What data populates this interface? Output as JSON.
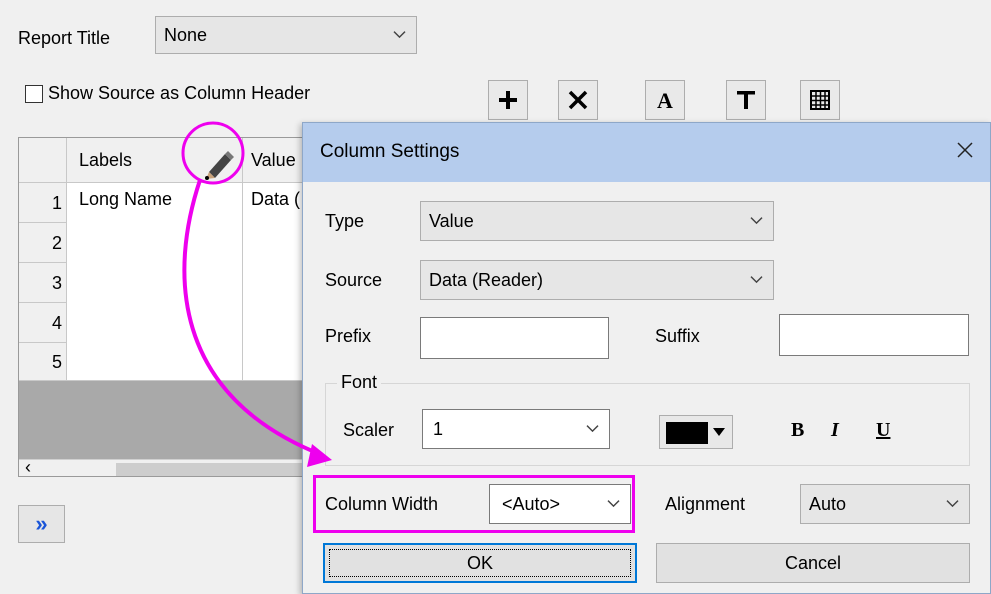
{
  "report": {
    "title_label": "Report Title",
    "title_value": "None",
    "show_source_label": "Show Source as Column Header",
    "toolbar_icons": [
      "plus-icon",
      "delete-x-icon",
      "font-a-icon",
      "text-t-icon",
      "table-grid-icon"
    ]
  },
  "grid": {
    "headers": [
      "Labels",
      "Value"
    ],
    "row_numbers": [
      "1",
      "2",
      "3",
      "4",
      "5"
    ],
    "rows": [
      [
        "Long Name",
        "Data ("
      ],
      [
        "",
        ""
      ],
      [
        "",
        ""
      ],
      [
        "",
        ""
      ],
      [
        "",
        ""
      ]
    ],
    "scroll_left": "‹",
    "edit_icon": "pencil-icon"
  },
  "expand_button": "»",
  "dialog": {
    "title": "Column Settings",
    "type_label": "Type",
    "type_value": "Value",
    "source_label": "Source",
    "source_value": "Data (Reader)",
    "prefix_label": "Prefix",
    "prefix_value": "",
    "suffix_label": "Suffix",
    "suffix_value": "",
    "font_group": "Font",
    "scaler_label": "Scaler",
    "scaler_value": "1",
    "bold_label": "B",
    "italic_label": "I",
    "underline_label": "U",
    "font_color": "#000000",
    "column_width_label": "Column Width",
    "column_width_value": "<Auto>",
    "alignment_label": "Alignment",
    "alignment_value": "Auto",
    "ok_label": "OK",
    "cancel_label": "Cancel"
  },
  "colors": {
    "highlight": "#ee00ee",
    "titlebar": "#b5cced",
    "focus_border": "#0078d7"
  }
}
